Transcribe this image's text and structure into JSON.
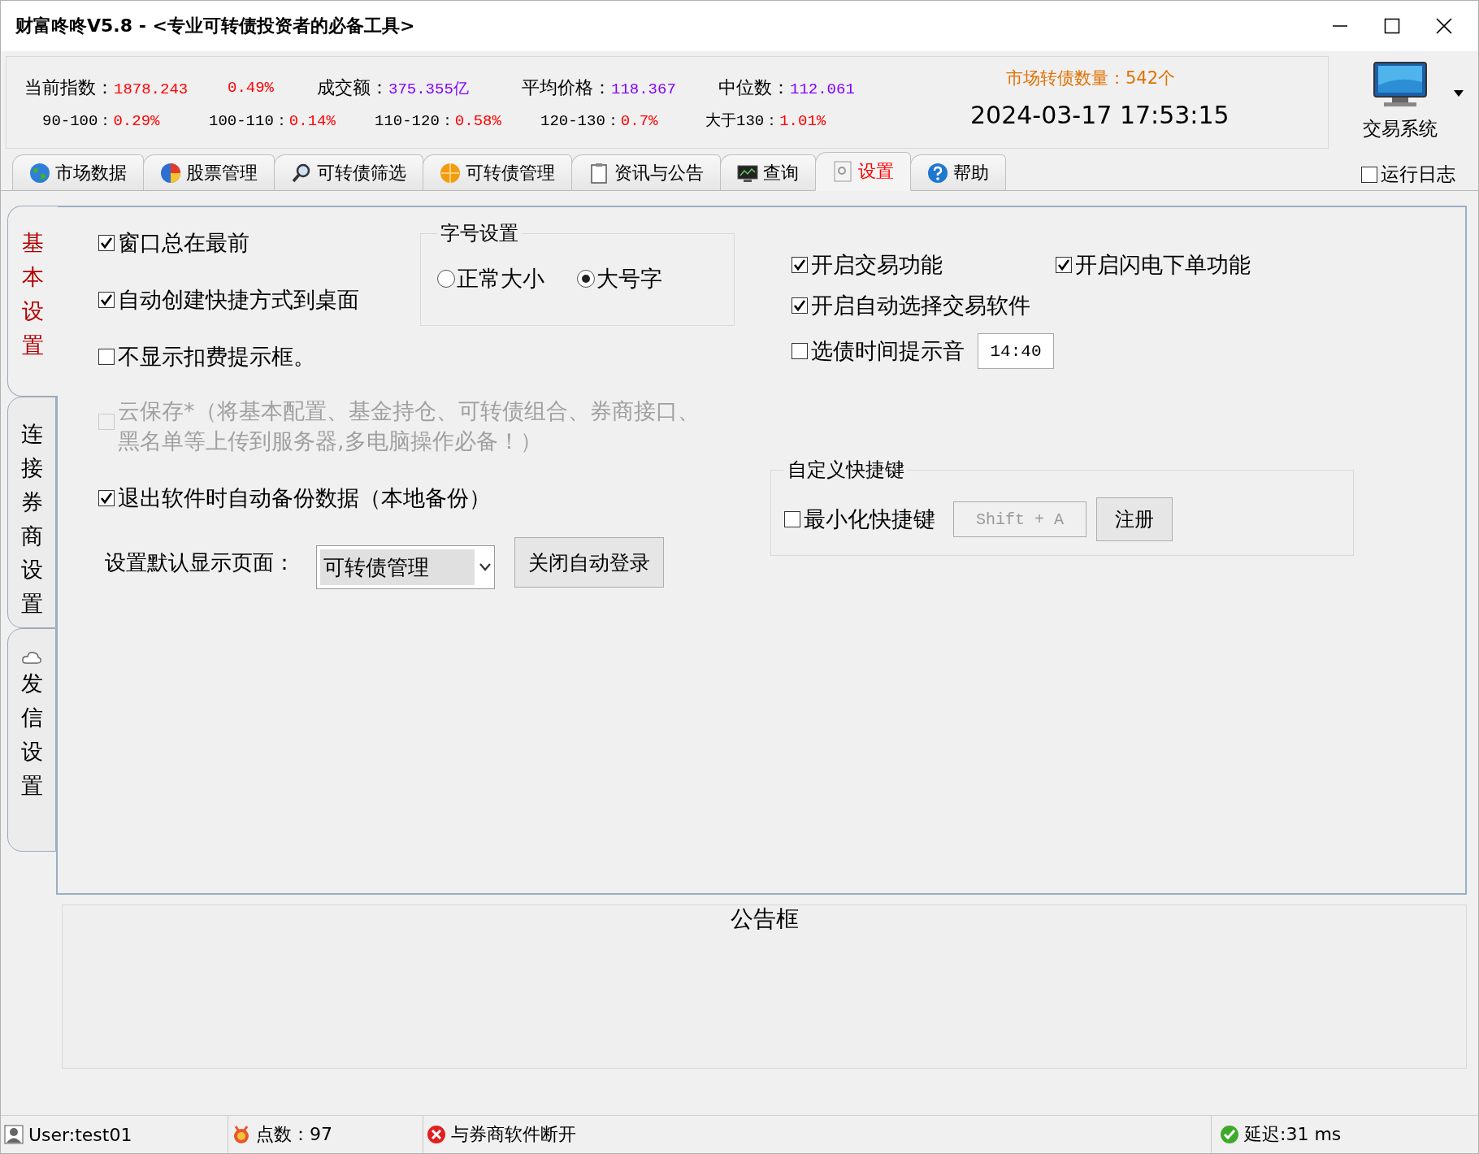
{
  "window": {
    "title": "财富咚咚V5.8 - <专业可转债投资者的必备工具>"
  },
  "market": {
    "rows": [
      {
        "items": [
          {
            "label": "当前指数：",
            "value": "1878.243",
            "color": "#ff0000"
          },
          {
            "value": "0.49%",
            "color": "#ff0000"
          },
          {
            "label": "成交额：",
            "value": "375.355亿",
            "color": "#8000ff"
          },
          {
            "label": "平均价格：",
            "value": "118.367",
            "color": "#8000ff"
          },
          {
            "label": "中位数：",
            "value": "112.061",
            "color": "#8000ff"
          }
        ]
      },
      {
        "items": [
          {
            "label": "90-100：",
            "value": "0.29%",
            "color": "#ff0000"
          },
          {
            "label": "100-110：",
            "value": "0.14%",
            "color": "#ff0000"
          },
          {
            "label": "110-120：",
            "value": "0.58%",
            "color": "#ff0000"
          },
          {
            "label": "120-130：",
            "value": "0.7%",
            "color": "#ff0000"
          },
          {
            "label": "大于130：",
            "value": "1.01%",
            "color": "#ff0000"
          }
        ]
      }
    ],
    "bond_count": "市场转债数量：542个",
    "datetime": "2024-03-17 17:53:15"
  },
  "trading_system": {
    "label": "交易系统"
  },
  "tabs": [
    {
      "label": "市场数据",
      "selected": false
    },
    {
      "label": "股票管理",
      "selected": false
    },
    {
      "label": "可转债筛选",
      "selected": false
    },
    {
      "label": "可转债管理",
      "selected": false
    },
    {
      "label": "资讯与公告",
      "selected": false
    },
    {
      "label": "查询",
      "selected": false
    },
    {
      "label": "设置",
      "selected": true
    },
    {
      "label": "帮助",
      "selected": false
    }
  ],
  "run_log": {
    "label": "运行日志",
    "checked": false
  },
  "side_tabs": [
    {
      "label": "基本设置",
      "selected": true
    },
    {
      "label": "连接券商设置",
      "selected": false
    },
    {
      "label": "发信设置",
      "selected": false
    }
  ],
  "settings": {
    "left_options": [
      {
        "label": "窗口总在最前",
        "checked": true,
        "disabled": false
      },
      {
        "label": "自动创建快捷方式到桌面",
        "checked": true,
        "disabled": false
      },
      {
        "label": "不显示扣费提示框。",
        "checked": false,
        "disabled": false
      },
      {
        "label": "云保存*（将基本配置、基金持仓、可转债组合、券商接口、黑名单等上传到服务器,多电脑操作必备！）",
        "checked": false,
        "disabled": true
      },
      {
        "label": "退出软件时自动备份数据（本地备份）",
        "checked": true,
        "disabled": false
      }
    ],
    "font_group": {
      "title": "字号设置",
      "options": [
        {
          "label": "正常大小",
          "selected": false
        },
        {
          "label": "大号字",
          "selected": true
        }
      ]
    },
    "default_page": {
      "label": "设置默认显示页面：",
      "value": "可转债管理"
    },
    "auto_login_button": "关闭自动登录",
    "right_options": [
      {
        "label": "开启交易功能",
        "checked": true
      },
      {
        "label": "开启闪电下单功能",
        "checked": true
      },
      {
        "label": "开启自动选择交易软件",
        "checked": true
      },
      {
        "label": "选债时间提示音",
        "checked": false
      }
    ],
    "reminder_time": "14:40",
    "hotkey_group": {
      "title": "自定义快捷键",
      "option": {
        "label": "最小化快捷键",
        "checked": false
      },
      "hotkey": "Shift + A",
      "register_button": "注册"
    }
  },
  "announcement": {
    "title": "公告框"
  },
  "status_bar": {
    "user": "User:test01",
    "points": "点数：97",
    "broker_status": "与券商软件断开",
    "latency": "延迟:31 ms"
  }
}
